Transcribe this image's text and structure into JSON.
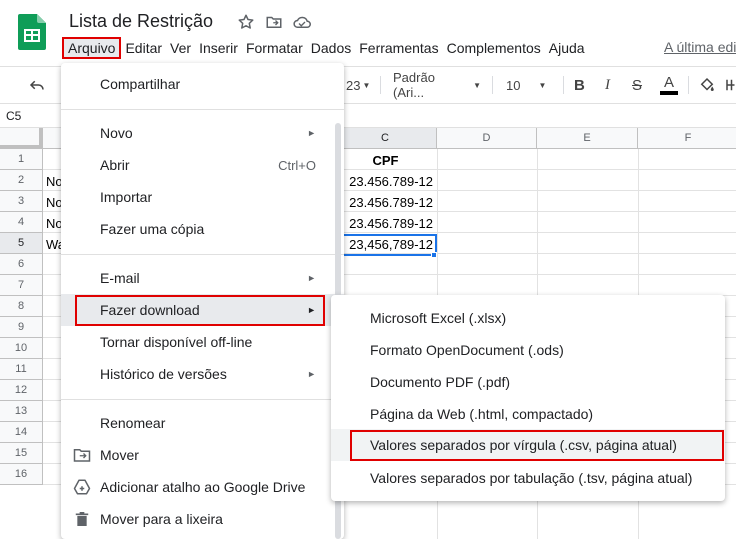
{
  "app": {
    "title": "Lista de Restrição",
    "last_edit": "A última edi"
  },
  "menubar": {
    "items": [
      "Arquivo",
      "Editar",
      "Ver",
      "Inserir",
      "Formatar",
      "Dados",
      "Ferramentas",
      "Complementos",
      "Ajuda"
    ],
    "active": "Arquivo"
  },
  "toolbar": {
    "number_format": "23",
    "font": "Padrão (Ari...",
    "font_size": "10",
    "bold": "B",
    "italic": "I",
    "strike": "S",
    "text_color": "A",
    "text_color_value": "#000000"
  },
  "formula_bar": {
    "name_box": "C5"
  },
  "grid": {
    "columns": [
      "C",
      "D",
      "E",
      "F"
    ],
    "selected_column": "C",
    "rows": [
      "1",
      "2",
      "3",
      "4",
      "5",
      "6",
      "7",
      "8",
      "9",
      "10",
      "11",
      "12",
      "13",
      "14",
      "15",
      "16"
    ],
    "selected_row": "5",
    "col_a_visible": [
      "",
      "No",
      "No",
      "No",
      "Wa"
    ],
    "col_c_values": [
      "CPF",
      "23.456.789-12",
      "23.456.789-12",
      "23.456.789-12",
      "23,456,789-12"
    ]
  },
  "file_menu": {
    "items": [
      {
        "label": "Compartilhar",
        "shortcut": "",
        "submenu": false,
        "icon": ""
      },
      {
        "label": "Novo",
        "shortcut": "",
        "submenu": true,
        "icon": ""
      },
      {
        "label": "Abrir",
        "shortcut": "Ctrl+O",
        "submenu": false,
        "icon": ""
      },
      {
        "label": "Importar",
        "shortcut": "",
        "submenu": false,
        "icon": ""
      },
      {
        "label": "Fazer uma cópia",
        "shortcut": "",
        "submenu": false,
        "icon": ""
      },
      {
        "label": "E-mail",
        "shortcut": "",
        "submenu": true,
        "icon": ""
      },
      {
        "label": "Fazer download",
        "shortcut": "",
        "submenu": true,
        "icon": ""
      },
      {
        "label": "Tornar disponível off-line",
        "shortcut": "",
        "submenu": false,
        "icon": ""
      },
      {
        "label": "Histórico de versões",
        "shortcut": "",
        "submenu": true,
        "icon": ""
      },
      {
        "label": "Renomear",
        "shortcut": "",
        "submenu": false,
        "icon": ""
      },
      {
        "label": "Mover",
        "shortcut": "",
        "submenu": false,
        "icon": "move-to-folder-icon"
      },
      {
        "label": "Adicionar atalho ao Google Drive",
        "shortcut": "",
        "submenu": false,
        "icon": "drive-shortcut-icon"
      },
      {
        "label": "Mover para a lixeira",
        "shortcut": "",
        "submenu": false,
        "icon": "trash-icon"
      }
    ]
  },
  "download_submenu": {
    "items": [
      "Microsoft Excel (.xlsx)",
      "Formato OpenDocument (.ods)",
      "Documento PDF (.pdf)",
      "Página da Web (.html, compactado)",
      "Valores separados por vírgula (.csv, página atual)",
      "Valores separados por tabulação (.tsv, página atual)"
    ],
    "highlighted": "Valores separados por vírgula (.csv, página atual)"
  },
  "colors": {
    "annotation_red": "#e00000",
    "selection_blue": "#1a73e8",
    "sheets_green": "#0f9d58"
  }
}
